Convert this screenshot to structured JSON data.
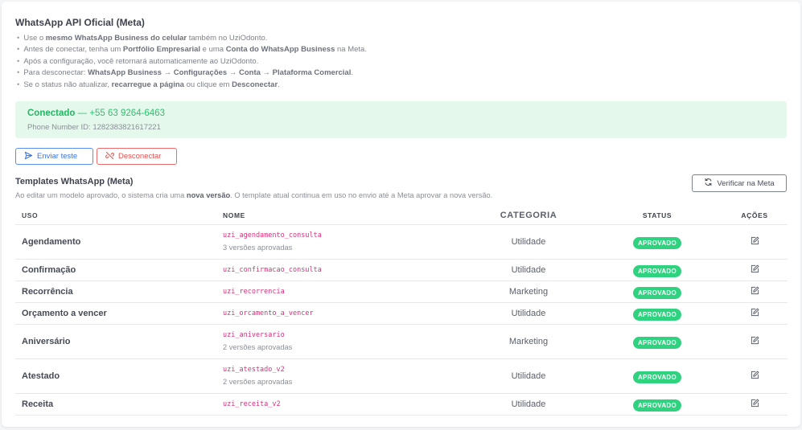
{
  "title": "WhatsApp API Oficial (Meta)",
  "bullets": [
    {
      "pre": "Use o ",
      "b1": "mesmo WhatsApp Business do celular",
      "mid": " também no UziOdonto.",
      "b2": "",
      "post": ""
    },
    {
      "pre": "Antes de conectar, tenha um ",
      "b1": "Portfólio Empresarial",
      "mid": " e uma ",
      "b2": "Conta do WhatsApp Business",
      "post": " na Meta."
    },
    {
      "pre": "Após a configuração, você retornará automaticamente ao UziOdonto.",
      "b1": "",
      "mid": "",
      "b2": "",
      "post": ""
    },
    {
      "pre": "Para desconectar: ",
      "b1": "WhatsApp Business → Configurações → Conta → Plataforma Comercial",
      "mid": ".",
      "b2": "",
      "post": ""
    },
    {
      "pre": "Se o status não atualizar, ",
      "b1": "recarregue a página",
      "mid": " ou clique em ",
      "b2": "Desconectar",
      "post": "."
    }
  ],
  "connection": {
    "status": "Conectado",
    "separator": " — ",
    "phone": "+55 63 9264-6463",
    "id_label": "Phone Number ID: 1282383821617221"
  },
  "buttons": {
    "send_test": "Enviar teste",
    "disconnect": "Desconectar",
    "verify": "Verificar na Meta"
  },
  "templates": {
    "title": "Templates WhatsApp (Meta)",
    "note_pre": "Ao editar um modelo aprovado, o sistema cria uma ",
    "note_bold": "nova versão",
    "note_post": ". O template atual continua em uso no envio até a Meta aprovar a nova versão.",
    "columns": [
      "USO",
      "NOME",
      "CATEGORIA",
      "STATUS",
      "AÇÕES"
    ],
    "rows": [
      {
        "uso": "Agendamento",
        "nome": "uzi_agendamento_consulta",
        "versions": "3 versões aprovadas",
        "categoria": "Utilidade",
        "status": "APROVADO"
      },
      {
        "uso": "Confirmação",
        "nome": "uzi_confirmacao_consulta",
        "versions": "",
        "categoria": "Utilidade",
        "status": "APROVADO"
      },
      {
        "uso": "Recorrência",
        "nome": "uzi_recorrencia",
        "versions": "",
        "categoria": "Marketing",
        "status": "APROVADO"
      },
      {
        "uso": "Orçamento a vencer",
        "nome": "uzi_orcamento_a_vencer",
        "versions": "",
        "categoria": "Utilidade",
        "status": "APROVADO"
      },
      {
        "uso": "Aniversário",
        "nome": "uzi_aniversario",
        "versions": "2 versões aprovadas",
        "categoria": "Marketing",
        "status": "APROVADO"
      },
      {
        "uso": "Atestado",
        "nome": "uzi_atestado_v2",
        "versions": "2 versões aprovadas",
        "categoria": "Utilidade",
        "status": "APROVADO"
      },
      {
        "uso": "Receita",
        "nome": "uzi_receita_v2",
        "versions": "",
        "categoria": "Utilidade",
        "status": "APROVADO"
      }
    ]
  },
  "colors": {
    "accent_blue": "#3d74e6",
    "danger_red": "#e44f4f",
    "success_green": "#2fd27e",
    "code_pink": "#d6337a",
    "connected_bg": "#e5f8ec"
  },
  "icons": {
    "send": "send-icon",
    "disconnect": "unlink-icon",
    "verify": "refresh-icon",
    "edit": "edit-icon"
  }
}
